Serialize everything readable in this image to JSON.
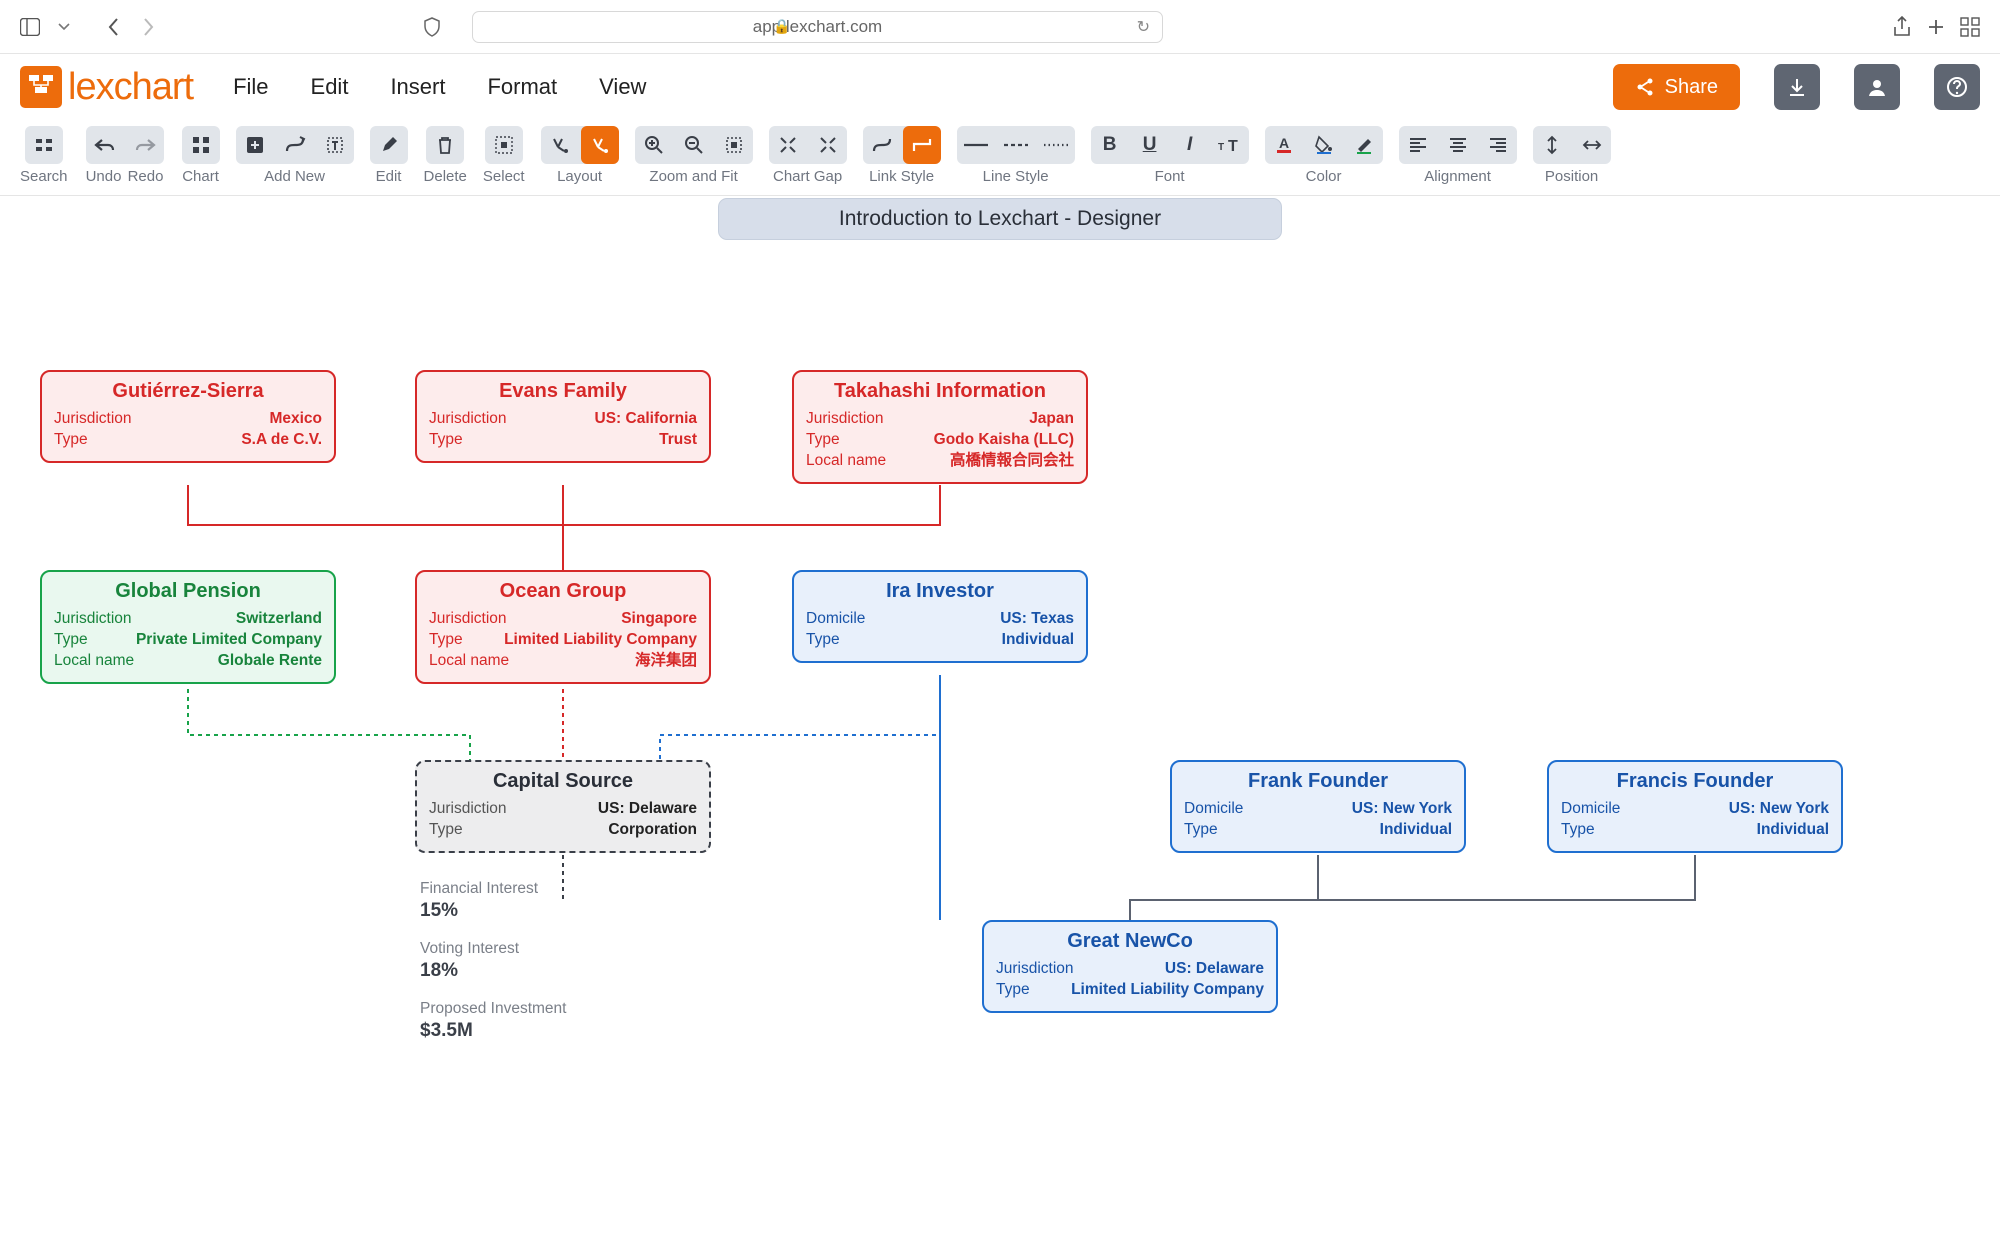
{
  "browser": {
    "url": "app.lexchart.com"
  },
  "brand": "lexchart",
  "menu": {
    "file": "File",
    "edit": "Edit",
    "insert": "Insert",
    "format": "Format",
    "view": "View"
  },
  "header": {
    "share": "Share"
  },
  "toolbar": {
    "search": "Search",
    "undo": "Undo",
    "redo": "Redo",
    "chart": "Chart",
    "addnew": "Add New",
    "edit": "Edit",
    "delete": "Delete",
    "select": "Select",
    "layout": "Layout",
    "zoomfit": "Zoom and Fit",
    "chartgap": "Chart Gap",
    "linkstyle": "Link Style",
    "linestyle": "Line Style",
    "font": "Font",
    "color": "Color",
    "alignment": "Alignment",
    "position": "Position"
  },
  "banner": "Introduction to Lexchart - Designer",
  "entities": {
    "gutierrez": {
      "name": "Gutiérrez-Sierra",
      "fields": [
        {
          "label": "Jurisdiction",
          "value": "Mexico"
        },
        {
          "label": "Type",
          "value": "S.A de C.V."
        }
      ]
    },
    "evans": {
      "name": "Evans Family",
      "fields": [
        {
          "label": "Jurisdiction",
          "value": "US: California"
        },
        {
          "label": "Type",
          "value": "Trust"
        }
      ]
    },
    "takahashi": {
      "name": "Takahashi Information",
      "fields": [
        {
          "label": "Jurisdiction",
          "value": "Japan"
        },
        {
          "label": "Type",
          "value": "Godo Kaisha (LLC)"
        },
        {
          "label": "Local name",
          "value": "高橋情報合同会社"
        }
      ]
    },
    "globalpension": {
      "name": "Global Pension",
      "fields": [
        {
          "label": "Jurisdiction",
          "value": "Switzerland"
        },
        {
          "label": "Type",
          "value": "Private Limited Company"
        },
        {
          "label": "Local name",
          "value": "Globale Rente"
        }
      ]
    },
    "ocean": {
      "name": "Ocean Group",
      "fields": [
        {
          "label": "Jurisdiction",
          "value": "Singapore"
        },
        {
          "label": "Type",
          "value": "Limited Liability Company"
        },
        {
          "label": "Local name",
          "value": "海洋集团"
        }
      ]
    },
    "ira": {
      "name": "Ira Investor",
      "fields": [
        {
          "label": "Domicile",
          "value": "US: Texas"
        },
        {
          "label": "Type",
          "value": "Individual"
        }
      ]
    },
    "capital": {
      "name": "Capital Source",
      "fields": [
        {
          "label": "Jurisdiction",
          "value": "US: Delaware"
        },
        {
          "label": "Type",
          "value": "Corporation"
        }
      ]
    },
    "frank": {
      "name": "Frank Founder",
      "fields": [
        {
          "label": "Domicile",
          "value": "US: New York"
        },
        {
          "label": "Type",
          "value": "Individual"
        }
      ]
    },
    "francis": {
      "name": "Francis Founder",
      "fields": [
        {
          "label": "Domicile",
          "value": "US: New York"
        },
        {
          "label": "Type",
          "value": "Individual"
        }
      ]
    },
    "newco": {
      "name": "Great NewCo",
      "fields": [
        {
          "label": "Jurisdiction",
          "value": "US: Delaware"
        },
        {
          "label": "Type",
          "value": "Limited Liability Company"
        }
      ]
    }
  },
  "metrics": {
    "fi_label": "Financial Interest",
    "fi_value": "15%",
    "vi_label": "Voting Interest",
    "vi_value": "18%",
    "pi_label": "Proposed Investment",
    "pi_value": "$3.5M"
  }
}
